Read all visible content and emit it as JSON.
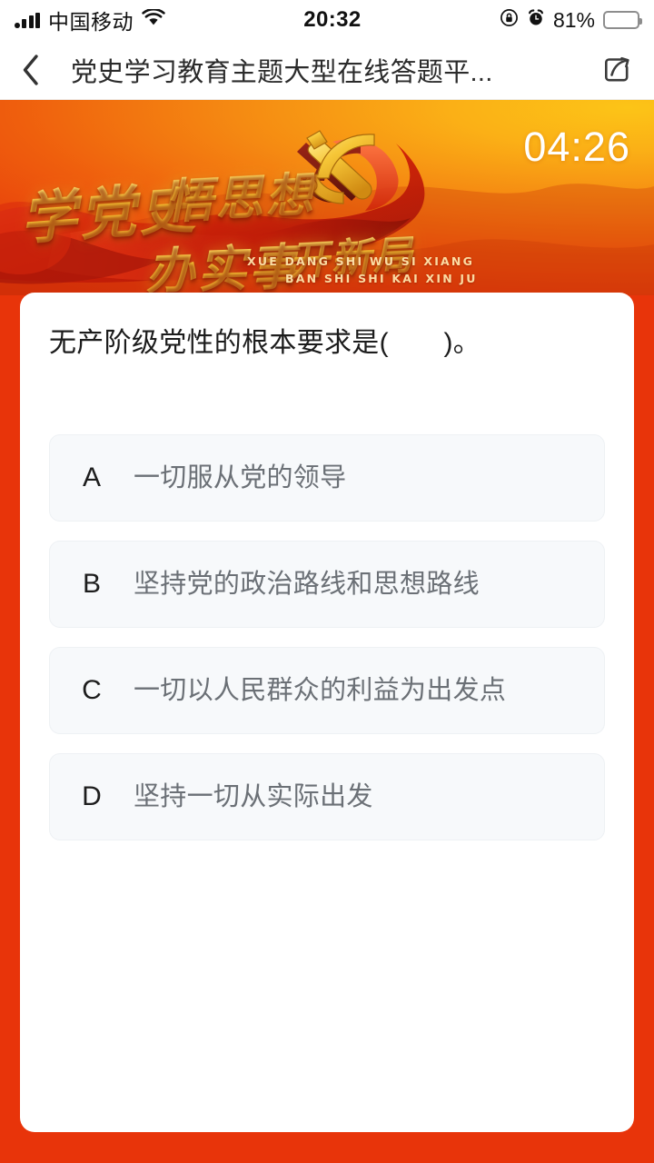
{
  "statusbar": {
    "signal_icon": "signal-bars-icon",
    "carrier": "中国移动",
    "wifi_icon": "wifi-icon",
    "time": "20:32",
    "rotation_lock_icon": "rotation-lock-icon",
    "alarm_icon": "alarm-clock-icon",
    "battery_percent": "81%",
    "battery_icon": "battery-full-icon"
  },
  "navbar": {
    "back_icon": "chevron-left-icon",
    "title": "党史学习教育主题大型在线答题平...",
    "share_icon": "share-icon"
  },
  "banner": {
    "timer": "04:26",
    "emblem_icon": "party-emblem-icon",
    "calligraphy": {
      "line1a": "学党史",
      "line1b": "悟思想",
      "line2a": "办实事",
      "line2b": "开新局"
    },
    "pinyin_line1": "XUE DANG SHI    WU SI XIANG",
    "pinyin_line2": "BAN SHI SHI    KAI XIN JU"
  },
  "quiz": {
    "question": "无产阶级党性的根本要求是(　　)。",
    "options": [
      {
        "letter": "A",
        "text": "一切服从党的领导"
      },
      {
        "letter": "B",
        "text": "坚持党的政治路线和思想路线"
      },
      {
        "letter": "C",
        "text": "一切以人民群众的利益为出发点"
      },
      {
        "letter": "D",
        "text": "坚持一切从实际出发"
      }
    ]
  },
  "colors": {
    "page_background": "#e8340a",
    "banner_gold": "#fcc417",
    "banner_red": "#e2330a",
    "card_background": "#ffffff",
    "option_background": "#f7f9fb",
    "option_text": "#6b7076",
    "timer_text": "#ffffff"
  }
}
